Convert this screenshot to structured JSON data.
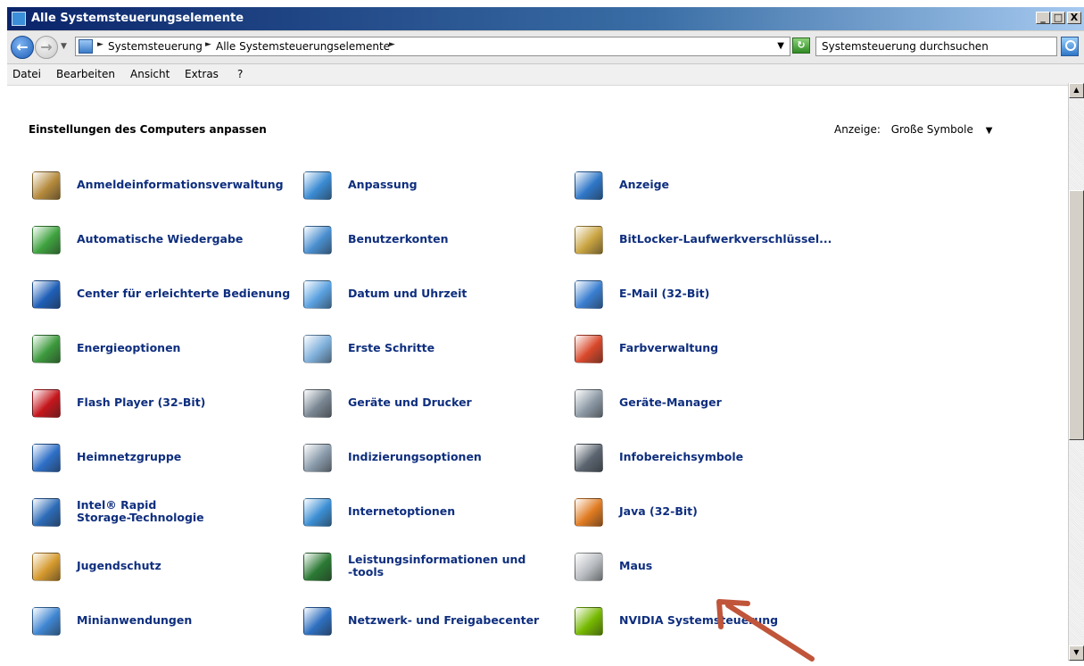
{
  "window": {
    "title": "Alle Systemsteuerungselemente",
    "controls": {
      "minimize": "_",
      "maximize": "□",
      "close": "X"
    }
  },
  "address": {
    "crumbs": [
      "Systemsteuerung",
      "Alle Systemsteuerungselemente"
    ],
    "search_placeholder": "Systemsteuerung durchsuchen"
  },
  "menu": [
    "Datei",
    "Bearbeiten",
    "Ansicht",
    "Extras",
    "?"
  ],
  "content": {
    "heading": "Einstellungen des Computers anpassen",
    "view_label": "Anzeige:",
    "view_value": "Große Symbole"
  },
  "items": [
    {
      "label": "Anmeldeinformationsverwaltung",
      "icon": "vault-icon",
      "color": "#b58a3c"
    },
    {
      "label": "Anpassung",
      "icon": "personalization-icon",
      "color": "#3b8bd3"
    },
    {
      "label": "Anzeige",
      "icon": "display-icon",
      "color": "#2f77c8"
    },
    {
      "label": "Automatische Wiedergabe",
      "icon": "autoplay-icon",
      "color": "#3fa33f"
    },
    {
      "label": "Benutzerkonten",
      "icon": "users-icon",
      "color": "#4a8fd0"
    },
    {
      "label": "BitLocker-Laufwerkverschlüssel...",
      "icon": "bitlocker-icon",
      "color": "#c9a441"
    },
    {
      "label": "Center für erleichterte Bedienung",
      "icon": "ease-of-access-icon",
      "color": "#1f5fb8"
    },
    {
      "label": "Datum und Uhrzeit",
      "icon": "calendar-clock-icon",
      "color": "#5aa1e0"
    },
    {
      "label": "E-Mail (32-Bit)",
      "icon": "mail-icon",
      "color": "#3a7fd1"
    },
    {
      "label": "Energieoptionen",
      "icon": "power-icon",
      "color": "#3d9a3d"
    },
    {
      "label": "Erste Schritte",
      "icon": "getting-started-icon",
      "color": "#7fb0db"
    },
    {
      "label": "Farbverwaltung",
      "icon": "color-management-icon",
      "color": "#d9482b"
    },
    {
      "label": "Flash Player (32-Bit)",
      "icon": "flash-icon",
      "color": "#c4161c"
    },
    {
      "label": "Geräte und Drucker",
      "icon": "printer-icon",
      "color": "#7a8793"
    },
    {
      "label": "Geräte-Manager",
      "icon": "device-manager-icon",
      "color": "#8d9aa6"
    },
    {
      "label": "Heimnetzgruppe",
      "icon": "homegroup-icon",
      "color": "#2e6fc7"
    },
    {
      "label": "Indizierungsoptionen",
      "icon": "indexing-icon",
      "color": "#8a9bab"
    },
    {
      "label": "Infobereichsymbole",
      "icon": "notification-area-icon",
      "color": "#5b6570"
    },
    {
      "label": "Intel® Rapid\nStorage-Technologie",
      "icon": "intel-storage-icon",
      "color": "#2c6bb8"
    },
    {
      "label": "Internetoptionen",
      "icon": "internet-options-icon",
      "color": "#3c8fd4"
    },
    {
      "label": "Java (32-Bit)",
      "icon": "java-icon",
      "color": "#e07b21"
    },
    {
      "label": "Jugendschutz",
      "icon": "parental-controls-icon",
      "color": "#d59a2e"
    },
    {
      "label": "Leistungsinformationen und\n-tools",
      "icon": "performance-icon",
      "color": "#2b7a34"
    },
    {
      "label": "Maus",
      "icon": "mouse-icon",
      "color": "#b8bcc0"
    },
    {
      "label": "Minianwendungen",
      "icon": "gadgets-icon",
      "color": "#3f86d2"
    },
    {
      "label": "Netzwerk- und Freigabecenter",
      "icon": "network-icon",
      "color": "#2e6fc0"
    },
    {
      "label": "NVIDIA Systemsteuerung",
      "icon": "nvidia-icon",
      "color": "#76b900"
    }
  ]
}
